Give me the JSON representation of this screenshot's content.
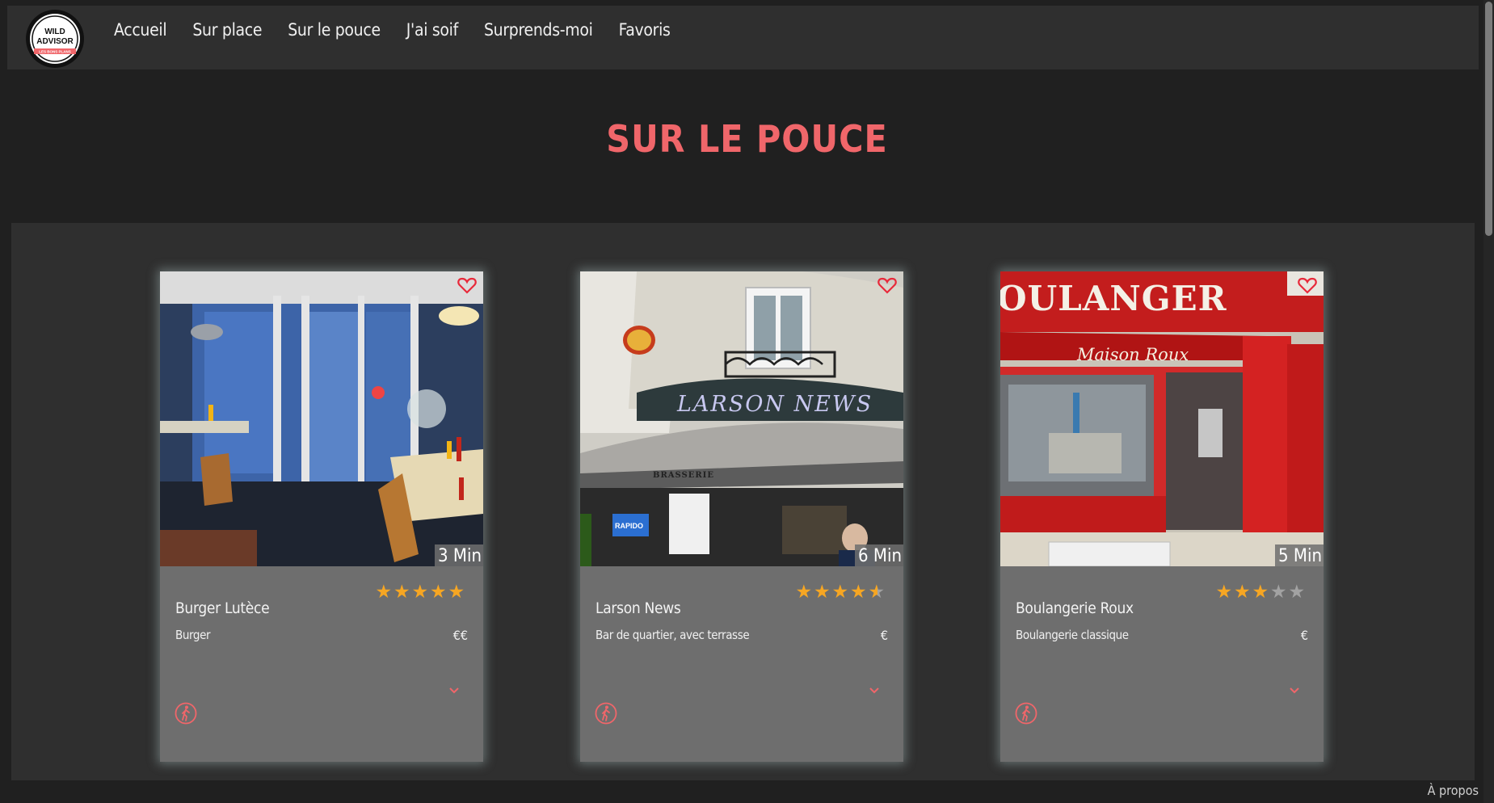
{
  "brand": {
    "logo_line1": "WILD",
    "logo_line2": "ADVISOR",
    "logo_tagline": "LES BONS PLANS"
  },
  "nav": {
    "items": [
      "Accueil",
      "Sur place",
      "Sur le pouce",
      "J'ai soif",
      "Surprends-moi",
      "Favoris"
    ]
  },
  "page": {
    "title": "SUR LE POUCE"
  },
  "cards": [
    {
      "name": "Burger Lutèce",
      "description": "Burger",
      "price": "€€",
      "time": "3 Min",
      "rating": 5,
      "favorite": false
    },
    {
      "name": "Larson News",
      "description": "Bar de quartier, avec terrasse",
      "price": "€",
      "time": "6 Min",
      "rating": 4.5,
      "favorite": false,
      "sign_text": "LARSON NEWS",
      "awning_text": "BRASSERIE"
    },
    {
      "name": "Boulangerie Roux",
      "description": "Boulangerie classique",
      "price": "€",
      "time": "5 Min",
      "rating": 3,
      "favorite": false,
      "sign_text": "OULANGER",
      "sub_sign_text": "Maison Roux"
    }
  ],
  "footer": {
    "about": "À propos"
  },
  "colors": {
    "accent": "#f0666a",
    "star": "#f6a623",
    "card_bg": "#6e6e6e",
    "nav_bg": "#2f2f2f"
  }
}
